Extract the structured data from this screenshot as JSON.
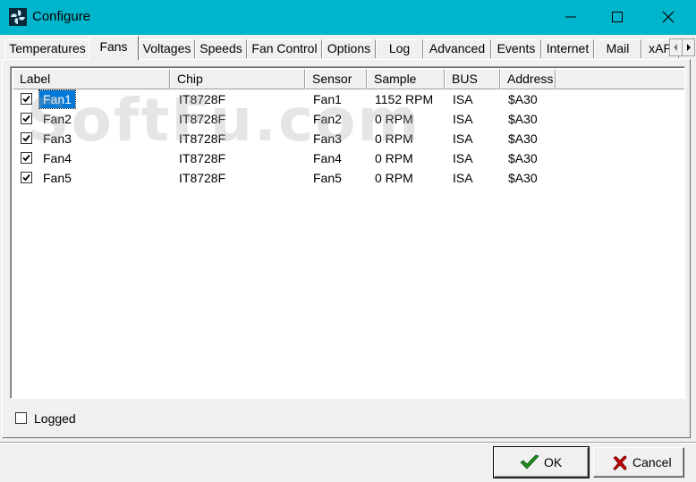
{
  "window": {
    "title": "Configure",
    "titlebar_color": "#00b5cc",
    "icon": "fan-app-icon"
  },
  "tabs": [
    {
      "label": "Temperatures",
      "active": false
    },
    {
      "label": "Fans",
      "active": true
    },
    {
      "label": "Voltages",
      "active": false
    },
    {
      "label": "Speeds",
      "active": false
    },
    {
      "label": "Fan Control",
      "active": false
    },
    {
      "label": "Options",
      "active": false
    },
    {
      "label": "Log",
      "active": false
    },
    {
      "label": "Advanced",
      "active": false
    },
    {
      "label": "Events",
      "active": false
    },
    {
      "label": "Internet",
      "active": false
    },
    {
      "label": "Mail",
      "active": false
    },
    {
      "label": "xAP",
      "active": false
    }
  ],
  "table": {
    "columns": [
      "Label",
      "Chip",
      "Sensor",
      "Sample",
      "BUS",
      "Address"
    ],
    "rows": [
      {
        "checked": true,
        "label": "Fan1",
        "chip": "IT8728F",
        "sensor": "Fan1",
        "sample": "1152 RPM",
        "bus": "ISA",
        "address": "$A30",
        "selected": true
      },
      {
        "checked": true,
        "label": "Fan2",
        "chip": "IT8728F",
        "sensor": "Fan2",
        "sample": "0 RPM",
        "bus": "ISA",
        "address": "$A30",
        "selected": false
      },
      {
        "checked": true,
        "label": "Fan3",
        "chip": "IT8728F",
        "sensor": "Fan3",
        "sample": "0 RPM",
        "bus": "ISA",
        "address": "$A30",
        "selected": false
      },
      {
        "checked": true,
        "label": "Fan4",
        "chip": "IT8728F",
        "sensor": "Fan4",
        "sample": "0 RPM",
        "bus": "ISA",
        "address": "$A30",
        "selected": false
      },
      {
        "checked": true,
        "label": "Fan5",
        "chip": "IT8728F",
        "sensor": "Fan5",
        "sample": "0 RPM",
        "bus": "ISA",
        "address": "$A30",
        "selected": false
      }
    ]
  },
  "logged": {
    "label": "Logged",
    "checked": false
  },
  "buttons": {
    "ok": {
      "label": "OK",
      "icon": "checkmark-icon",
      "color": "#1e8a1e"
    },
    "cancel": {
      "label": "Cancel",
      "icon": "cross-icon",
      "color": "#c00000"
    }
  },
  "watermark": "SoftFu.com",
  "selection_color": "#0078d7"
}
